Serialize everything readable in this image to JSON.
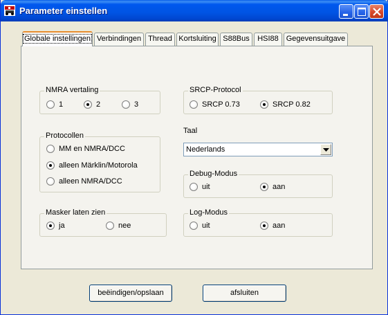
{
  "window": {
    "title": "Parameter einstellen",
    "controls": {
      "minimize_icon": "minimize-icon",
      "maximize_icon": "maximize-icon",
      "close_icon": "close-icon"
    }
  },
  "tabs": [
    {
      "label": "Globale instellingen",
      "active": true
    },
    {
      "label": "Verbindingen"
    },
    {
      "label": "Thread"
    },
    {
      "label": "Kortsluiting"
    },
    {
      "label": "S88Bus"
    },
    {
      "label": "HSI88"
    },
    {
      "label": "Gegevensuitgave"
    }
  ],
  "nmra": {
    "legend": "NMRA vertaling",
    "options": [
      "1",
      "2",
      "3"
    ],
    "selected": "2"
  },
  "protocollen": {
    "legend": "Protocollen",
    "options": [
      "MM en NMRA/DCC",
      "alleen Märklin/Motorola",
      "alleen NMRA/DCC"
    ],
    "selected": "alleen Märklin/Motorola"
  },
  "masker": {
    "legend": "Masker laten zien",
    "options": [
      "ja",
      "nee"
    ],
    "selected": "ja"
  },
  "srcp": {
    "legend": "SRCP-Protocol",
    "options": [
      "SRCP 0.73",
      "SRCP 0.82"
    ],
    "selected": "SRCP 0.82"
  },
  "taal": {
    "label": "Taal",
    "value": "Nederlands"
  },
  "debug": {
    "legend": "Debug-Modus",
    "options": [
      "uit",
      "aan"
    ],
    "selected": "aan"
  },
  "log": {
    "legend": "Log-Modus",
    "options": [
      "uit",
      "aan"
    ],
    "selected": "aan"
  },
  "buttons": {
    "save": "beëindigen/opslaan",
    "close": "afsluiten"
  },
  "colors": {
    "title_bar": "#0054e3",
    "tab_accent": "#e68b2c",
    "close_button": "#d7482a"
  }
}
